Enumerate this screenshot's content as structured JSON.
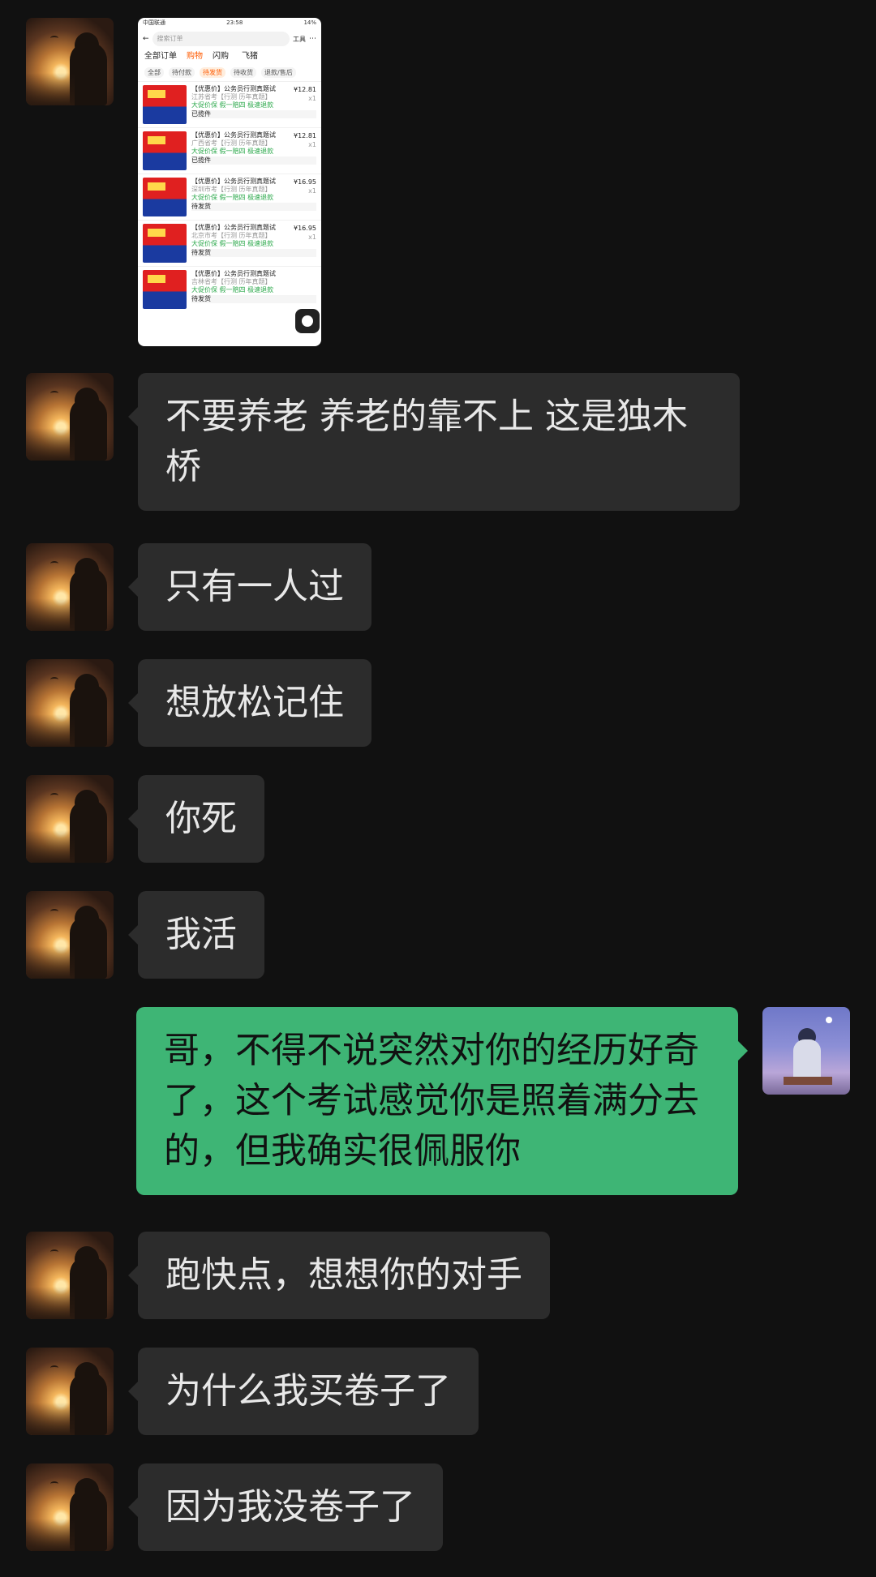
{
  "image_message": {
    "status_bar": {
      "carrier": "中国联通",
      "time": "23:58",
      "battery": "14%"
    },
    "search_placeholder": "搜索订单",
    "tools_label": "工具",
    "tabs": [
      "全部订单",
      "购物",
      "闪购",
      "飞猪"
    ],
    "sub_tabs": [
      "全部",
      "待付款",
      "待发货",
      "待收货",
      "退款/售后"
    ],
    "orders": [
      {
        "title": "【优惠价】公务员行测真题试",
        "sub": "江苏省考【行测 历年真题】",
        "green": "大促价保 假一赔四 极速退款",
        "status": "已揽件",
        "price": "¥12.81",
        "qty": "x1"
      },
      {
        "title": "【优惠价】公务员行测真题试",
        "sub": "广西省考【行测 历年真题】",
        "green": "大促价保 假一赔四 极速退款",
        "status": "已揽件",
        "price": "¥12.81",
        "qty": "x1"
      },
      {
        "title": "【优惠价】公务员行测真题试",
        "sub": "深圳市考【行测 历年真题】",
        "green": "大促价保 假一赔四 极速退款",
        "status": "待发货",
        "price": "¥16.95",
        "qty": "x1"
      },
      {
        "title": "【优惠价】公务员行测真题试",
        "sub": "北京市考【行测 历年真题】",
        "green": "大促价保 假一赔四 极速退款",
        "status": "待发货",
        "price": "¥16.95",
        "qty": "x1"
      },
      {
        "title": "【优惠价】公务员行测真题试",
        "sub": "吉林省考【行测 历年真题】",
        "green": "大促价保 假一赔四 极速退款",
        "status": "待发货",
        "price": "",
        "qty": ""
      }
    ]
  },
  "messages": [
    {
      "side": "left",
      "text": "不要养老 养老的靠不上 这是独木桥"
    },
    {
      "side": "left",
      "text": "只有一人过"
    },
    {
      "side": "left",
      "text": "想放松记住"
    },
    {
      "side": "left",
      "text": "你死"
    },
    {
      "side": "left",
      "text": "我活"
    },
    {
      "side": "right",
      "text": "哥，不得不说突然对你的经历好奇了，这个考试感觉你是照着满分去的，但我确实很佩服你"
    },
    {
      "side": "left",
      "text": "跑快点，想想你的对手"
    },
    {
      "side": "left",
      "text": "为什么我买卷子了"
    },
    {
      "side": "left",
      "text": "因为我没卷子了"
    }
  ]
}
